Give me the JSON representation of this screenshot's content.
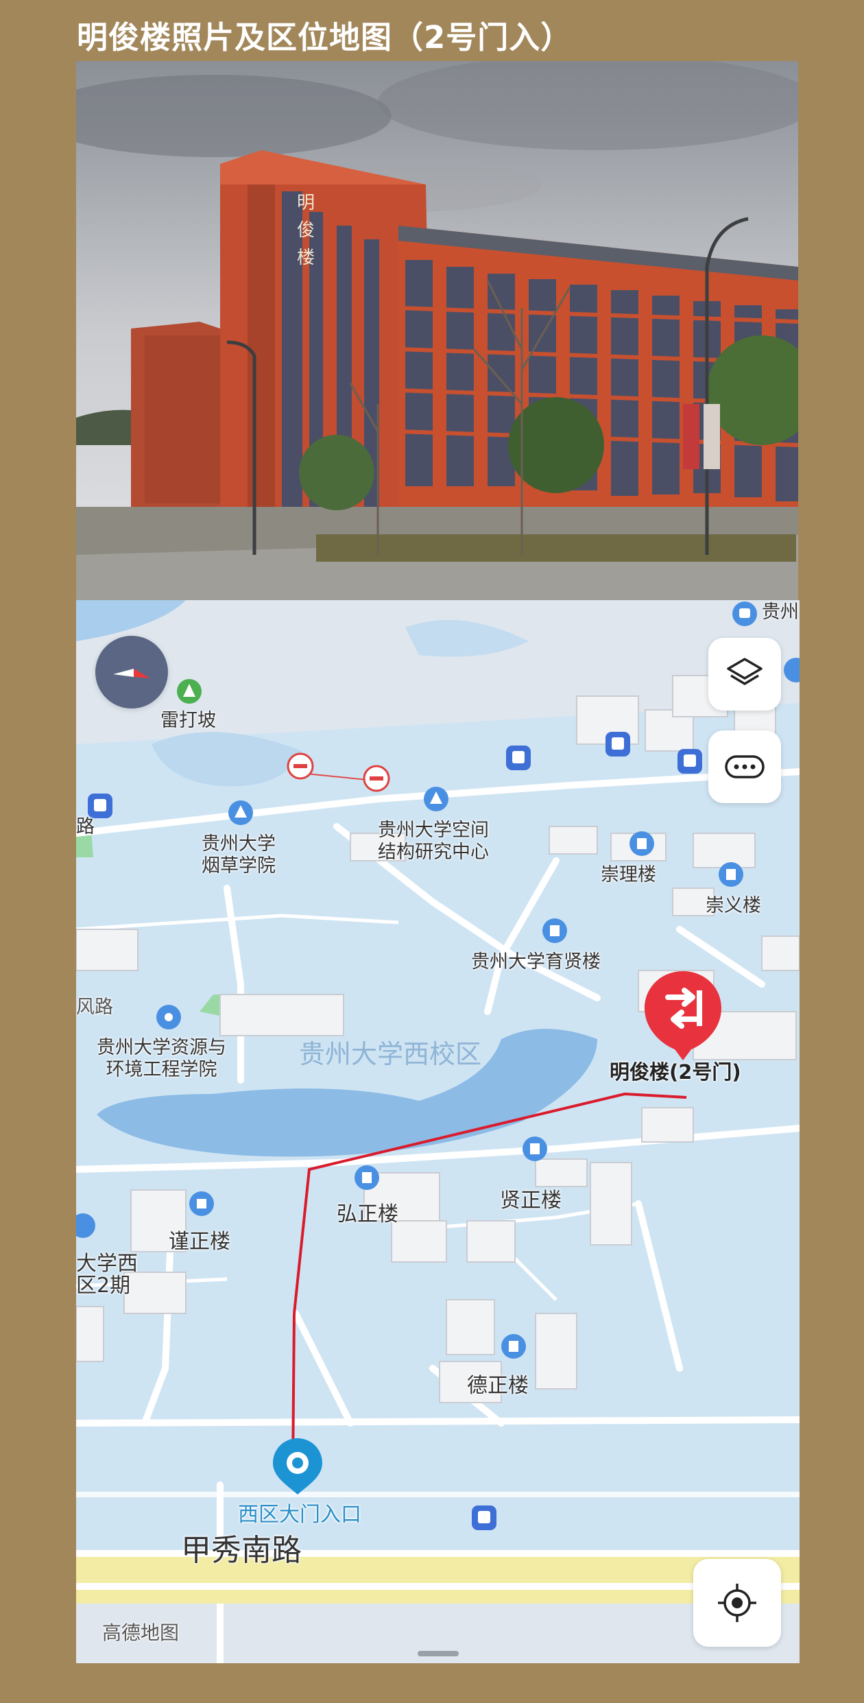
{
  "header": {
    "title": "明俊楼照片及区位地图（2号门入）"
  },
  "photo": {
    "sign_text": "明\n俊\n楼",
    "accent": "#c8502f"
  },
  "map": {
    "compass_icon": "compass-icon",
    "layers_icon": "layers-icon",
    "more_icon": "more-icon",
    "locate_icon": "locate-icon",
    "labels": {
      "leidapo": "雷打坡",
      "tobacco": "贵州大学\n烟草学院",
      "space": "贵州大学空间\n结构研究中心",
      "chongli": "崇理楼",
      "chongyi": "崇义楼",
      "yuxian": "贵州大学育贤楼",
      "fenglu": "风路",
      "resources": "贵州大学资源与\n环境工程学院",
      "campus": "贵州大学西校区",
      "mingjun": "明俊楼(2号门)",
      "xianzheng": "贤正楼",
      "hongzheng": "弘正楼",
      "jinzheng": "谨正楼",
      "west2": "大学西\n区2期",
      "dezheng": "德正楼",
      "gate": "西区大门入口",
      "road": "甲秀南路",
      "topright": "贵州",
      "lu": "路",
      "logo": "高德地图"
    }
  }
}
